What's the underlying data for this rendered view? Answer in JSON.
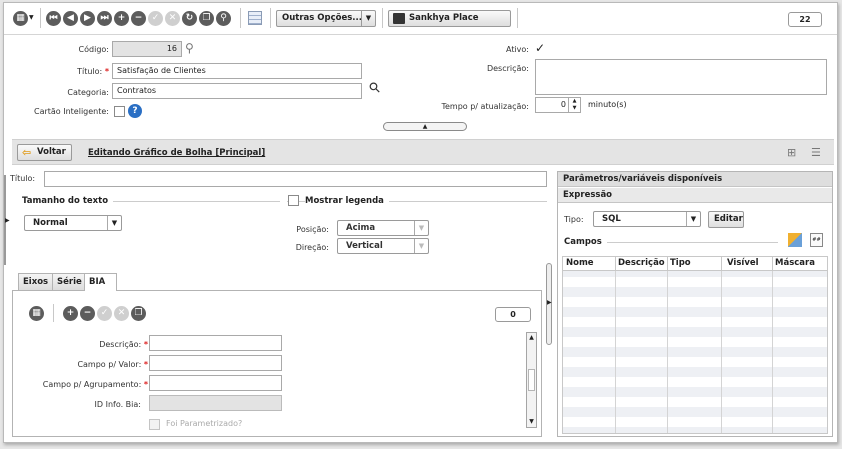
{
  "toolbar": {
    "outras_opcoes": "Outras Opções...",
    "sankhya_place": "Sankhya Place",
    "record_count": "22"
  },
  "form": {
    "codigo_label": "Código:",
    "codigo_value": "16",
    "titulo_label": "Título:",
    "titulo_value": "Satisfação de Clientes",
    "categoria_label": "Categoria:",
    "categoria_value": "Contratos",
    "cartao_label": "Cartão Inteligente:",
    "ativo_label": "Ativo:",
    "ativo_mark": "✓",
    "descricao_label": "Descrição:",
    "tempo_label": "Tempo p/ atualização:",
    "tempo_value": "0",
    "tempo_unit": "minuto(s)",
    "help_mark": "?"
  },
  "editbar": {
    "voltar": "Voltar",
    "title": "Editando Gráfico de Bolha [Principal]"
  },
  "chart_form": {
    "titulo_label": "Título:",
    "tamanho_section": "Tamanho do texto",
    "tamanho_value": "Normal",
    "mostrar_legenda": "Mostrar legenda",
    "posicao_label": "Posição:",
    "posicao_value": "Acima",
    "direcao_label": "Direção:",
    "direcao_value": "Vertical"
  },
  "tabs": [
    "Eixos",
    "Série",
    "BIA"
  ],
  "bia": {
    "count": "0",
    "descricao_label": "Descrição:",
    "campo_valor_label": "Campo p/ Valor:",
    "campo_agrup_label": "Campo p/ Agrupamento:",
    "id_info_label": "ID Info. Bia:",
    "foi_param_label": "Foi Parametrizado?",
    "required_mark": "*"
  },
  "params": {
    "header": "Parâmetros/variáveis disponíveis",
    "expressao": "Expressão",
    "tipo_label": "Tipo:",
    "tipo_value": "SQL",
    "editar": "Editar",
    "campos": "Campos",
    "columns": [
      "Nome",
      "Descrição",
      "Tipo",
      "Visível",
      "Máscara"
    ]
  }
}
